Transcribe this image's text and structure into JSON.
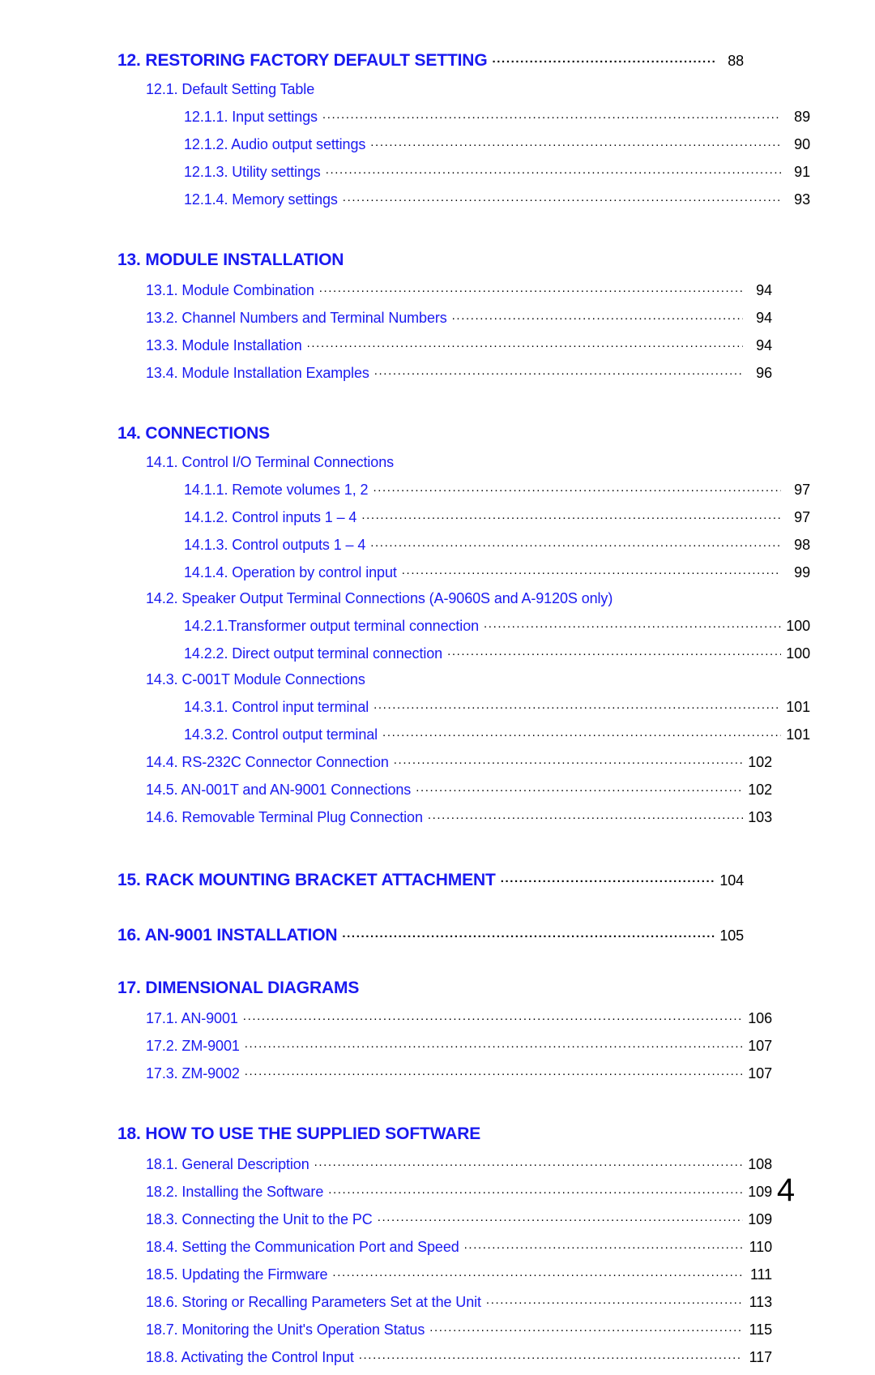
{
  "document": {
    "folio": "4"
  },
  "toc": {
    "sections": [
      {
        "id": "sec-12",
        "heading": {
          "label": "12. RESTORING FACTORY DEFAULT SETTING",
          "page": "88",
          "dots": true
        },
        "entries": [
          {
            "level": 2,
            "label": "12.1. Default Setting Table",
            "page": "",
            "dots": false
          },
          {
            "level": 3,
            "label": "12.1.1. Input settings",
            "page": "89",
            "dots": true
          },
          {
            "level": 3,
            "label": "12.1.2. Audio output settings",
            "page": "90",
            "dots": true
          },
          {
            "level": 3,
            "label": "12.1.3. Utility settings",
            "page": "91",
            "dots": true
          },
          {
            "level": 3,
            "label": "12.1.4. Memory settings",
            "page": "93",
            "dots": true
          }
        ]
      },
      {
        "id": "sec-13",
        "heading": {
          "label": "13. MODULE INSTALLATION",
          "page": "",
          "dots": false
        },
        "entries": [
          {
            "level": 2,
            "label": "13.1. Module Combination",
            "page": "94",
            "dots": true
          },
          {
            "level": 2,
            "label": "13.2. Channel Numbers and Terminal Numbers",
            "page": "94",
            "dots": true
          },
          {
            "level": 2,
            "label": "13.3. Module Installation",
            "page": "94",
            "dots": true
          },
          {
            "level": 2,
            "label": "13.4. Module Installation Examples",
            "page": "96",
            "dots": true
          }
        ]
      },
      {
        "id": "sec-14",
        "heading": {
          "label": "14. CONNECTIONS",
          "page": "",
          "dots": false
        },
        "entries": [
          {
            "level": 2,
            "label": "14.1. Control I/O Terminal Connections",
            "page": "",
            "dots": false
          },
          {
            "level": 3,
            "label": "14.1.1. Remote volumes 1, 2",
            "page": "97",
            "dots": true
          },
          {
            "level": 3,
            "label": "14.1.2. Control inputs 1 – 4",
            "page": "97",
            "dots": true
          },
          {
            "level": 3,
            "label": "14.1.3. Control outputs 1 – 4",
            "page": "98",
            "dots": true
          },
          {
            "level": 3,
            "label": "14.1.4. Operation by control input",
            "page": "99",
            "dots": true
          },
          {
            "level": 2,
            "label": "14.2. Speaker Output Terminal Connections (A-9060S and A-9120S only)",
            "page": "",
            "dots": false
          },
          {
            "level": 3,
            "label": "14.2.1.Transformer output terminal connection",
            "page": "100",
            "dots": true
          },
          {
            "level": 3,
            "label": "14.2.2. Direct output terminal connection",
            "page": "100",
            "dots": true
          },
          {
            "level": 2,
            "label": "14.3. C-001T Module Connections",
            "page": "",
            "dots": false
          },
          {
            "level": 3,
            "label": "14.3.1. Control input terminal",
            "page": "101",
            "dots": true
          },
          {
            "level": 3,
            "label": "14.3.2. Control output terminal",
            "page": "101",
            "dots": true
          },
          {
            "level": 2,
            "label": "14.4. RS-232C Connector Connection",
            "page": "102",
            "dots": true
          },
          {
            "level": 2,
            "label": "14.5. AN-001T and AN-9001 Connections",
            "page": "102",
            "dots": true
          },
          {
            "level": 2,
            "label": "14.6. Removable Terminal Plug Connection",
            "page": "103",
            "dots": true
          }
        ]
      },
      {
        "id": "sec-15",
        "heading": {
          "label": "15. RACK MOUNTING BRACKET ATTACHMENT",
          "page": "104",
          "dots": true
        },
        "entries": []
      },
      {
        "id": "sec-16",
        "heading": {
          "label": "16. AN-9001 INSTALLATION",
          "page": "105",
          "dots": true
        },
        "entries": []
      },
      {
        "id": "sec-17",
        "heading": {
          "label": "17. DIMENSIONAL DIAGRAMS",
          "page": "",
          "dots": false
        },
        "entries": [
          {
            "level": 2,
            "label": "17.1. AN-9001",
            "page": "106",
            "dots": true
          },
          {
            "level": 2,
            "label": "17.2. ZM-9001",
            "page": "107",
            "dots": true
          },
          {
            "level": 2,
            "label": "17.3. ZM-9002",
            "page": "107",
            "dots": true
          }
        ]
      },
      {
        "id": "sec-18",
        "heading": {
          "label": "18. HOW TO USE THE SUPPLIED SOFTWARE",
          "page": "",
          "dots": false
        },
        "entries": [
          {
            "level": 2,
            "label": "18.1. General Description",
            "page": "108",
            "dots": true
          },
          {
            "level": 2,
            "label": "18.2. Installing the Software",
            "page": "109",
            "dots": true
          },
          {
            "level": 2,
            "label": "18.3. Connecting the Unit to the PC",
            "page": "109",
            "dots": true
          },
          {
            "level": 2,
            "label": "18.4. Setting the Communication Port and Speed",
            "page": "110",
            "dots": true
          },
          {
            "level": 2,
            "label": "18.5. Updating the Firmware",
            "page": "111",
            "dots": true
          },
          {
            "level": 2,
            "label": "18.6. Storing or Recalling Parameters Set at the Unit",
            "page": "113",
            "dots": true
          },
          {
            "level": 2,
            "label": "18.7. Monitoring the Unit's Operation Status",
            "page": "115",
            "dots": true
          },
          {
            "level": 2,
            "label": "18.8. Activating the Control Input",
            "page": "117",
            "dots": true
          }
        ]
      }
    ],
    "section_gaps": {
      "sec-12": 41,
      "sec-13": 41,
      "sec-14": 41,
      "sec-15": 28,
      "sec-16": 28,
      "sec-17": 41,
      "sec-18": 0
    }
  },
  "colors": {
    "link_blue": "#1a1af0",
    "page_number_black": "#000000",
    "leader_black": "#000000",
    "background": "#ffffff"
  }
}
